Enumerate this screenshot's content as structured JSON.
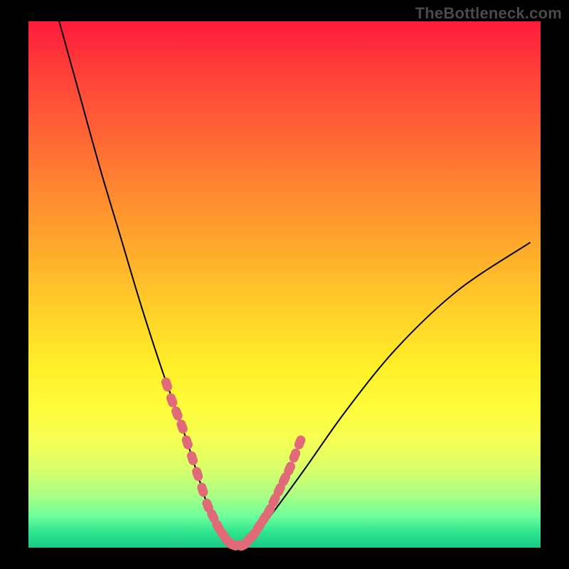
{
  "watermark": "TheBottleneck.com",
  "chart_data": {
    "type": "line",
    "title": "",
    "xlabel": "",
    "ylabel": "",
    "xlim": [
      0,
      100
    ],
    "ylim": [
      0,
      100
    ],
    "grid": false,
    "legend": false,
    "series": [
      {
        "name": "main-curve",
        "color": "#000000",
        "x": [
          6,
          10,
          14,
          18,
          22,
          26,
          30,
          33,
          35,
          37,
          38.5,
          40,
          42,
          44,
          48,
          54,
          62,
          72,
          84,
          98
        ],
        "y": [
          100,
          86,
          72,
          59,
          46,
          34,
          23,
          14,
          8,
          4,
          2,
          0.5,
          0.5,
          2,
          7,
          15,
          26,
          38,
          49,
          58
        ]
      },
      {
        "name": "highlight-points",
        "color": "#e06a77",
        "type": "scatter",
        "x": [
          27,
          28,
          29,
          30,
          31,
          32,
          33,
          34,
          35,
          36,
          37,
          38,
          39,
          40,
          41,
          42,
          43,
          44,
          45,
          46,
          47,
          48,
          49,
          50,
          51,
          52,
          53
        ],
        "y": [
          31,
          28,
          25.5,
          23,
          20,
          17,
          14,
          11,
          8,
          6,
          4,
          2.5,
          1.2,
          0.5,
          0.5,
          0.5,
          1.5,
          2.5,
          4,
          5.5,
          7,
          9,
          11,
          13,
          15,
          17.5,
          20
        ]
      }
    ],
    "annotations": []
  }
}
